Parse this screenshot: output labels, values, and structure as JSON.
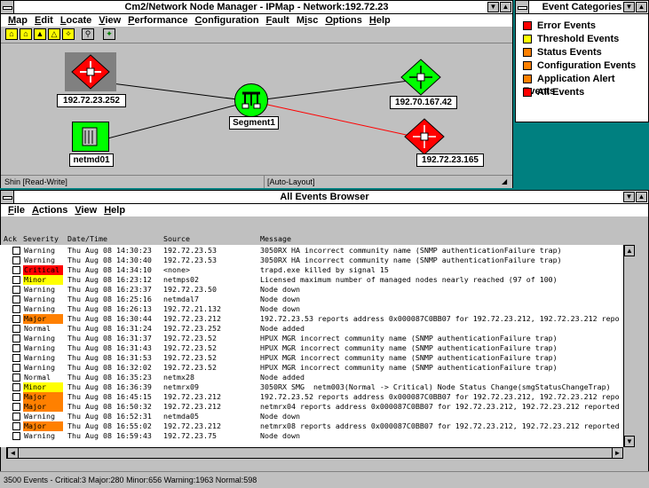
{
  "map_window": {
    "title": "Cm2/Network Node Manager - IPMap - Network:192.72.23",
    "menu": [
      {
        "label": "Map",
        "key": "M"
      },
      {
        "label": "Edit",
        "key": "E"
      },
      {
        "label": "Locate",
        "key": "L"
      },
      {
        "label": "View",
        "key": "V"
      },
      {
        "label": "Performance",
        "key": "P"
      },
      {
        "label": "Configuration",
        "key": "C"
      },
      {
        "label": "Fault",
        "key": "F"
      },
      {
        "label": "Misc",
        "key": "i"
      },
      {
        "label": "Options",
        "key": "O"
      },
      {
        "label": "Help",
        "key": "H"
      }
    ],
    "nodes": [
      {
        "label": "192.72.23.252",
        "color": "#ff0000",
        "icon": "router-icon"
      },
      {
        "label": "netmd01",
        "color": "#00ff00",
        "icon": "workstation-icon"
      },
      {
        "label": "Segment1",
        "color": "#00ff00",
        "icon": "segment-icon"
      },
      {
        "label": "192.70.167.42",
        "color": "#00ff00",
        "icon": "router-icon"
      },
      {
        "label": "192.72.23.165",
        "color": "#ff0000",
        "icon": "router-icon"
      }
    ],
    "status_left": "Shin [Read-Write]",
    "status_mid": "[Auto-Layout]"
  },
  "event_categories": {
    "title": "Event Categories",
    "items": [
      {
        "label": "Error Events",
        "color": "#ff0000"
      },
      {
        "label": "Threshold Events",
        "color": "#ffff00"
      },
      {
        "label": "Status Events",
        "color": "#ff8000"
      },
      {
        "label": "Configuration Events",
        "color": "#ff8000"
      },
      {
        "label": "Application Alert Events",
        "color": "#ff8000"
      },
      {
        "label": "All Events",
        "color": "#ff0000"
      }
    ]
  },
  "browser": {
    "title": "All Events Browser",
    "menu": [
      {
        "label": "File",
        "key": "F"
      },
      {
        "label": "Actions",
        "key": "A"
      },
      {
        "label": "View",
        "key": "V"
      },
      {
        "label": "Help",
        "key": "H"
      }
    ],
    "columns": {
      "ack": "Ack",
      "severity": "Severity",
      "date": "Date/Time",
      "source": "Source",
      "message": "Message"
    },
    "rows": [
      {
        "severity": "Warning",
        "color": "#ffffff",
        "date": "Thu Aug 08 14:30:23",
        "source": "192.72.23.53",
        "message": "3050RX HA incorrect community name (SNMP authenticationFailure trap)"
      },
      {
        "severity": "Warning",
        "color": "#ffffff",
        "date": "Thu Aug 08 14:30:40",
        "source": "192.72.23.53",
        "message": "3050RX HA incorrect community name (SNMP authenticationFailure trap)"
      },
      {
        "severity": "Critical",
        "color": "#ff0000",
        "date": "Thu Aug 08 14:34:10",
        "source": "<none>",
        "message": "trapd.exe killed by signal 15"
      },
      {
        "severity": "Minor",
        "color": "#ffff00",
        "date": "Thu Aug 08 16:23:12",
        "source": "netmps02",
        "message": "Licensed maximum number of managed nodes nearly reached (97 of 100)"
      },
      {
        "severity": "Warning",
        "color": "#ffffff",
        "date": "Thu Aug 08 16:23:37",
        "source": "192.72.23.50",
        "message": "Node down"
      },
      {
        "severity": "Warning",
        "color": "#ffffff",
        "date": "Thu Aug 08 16:25:16",
        "source": "netmdal7",
        "message": "Node down"
      },
      {
        "severity": "Warning",
        "color": "#ffffff",
        "date": "Thu Aug 08 16:26:13",
        "source": "192.72.21.132",
        "message": "Node down"
      },
      {
        "severity": "Major",
        "color": "#ff8000",
        "date": "Thu Aug 08 16:30:44",
        "source": "192.72.23.212",
        "message": "192.72.23.53 reports address 0x000087C0BB07 for 192.72.23.212, 192.72.23.212 repo"
      },
      {
        "severity": "Normal",
        "color": "#ffffff",
        "date": "Thu Aug 08 16:31:24",
        "source": "192.72.23.252",
        "message": "Node added"
      },
      {
        "severity": "Warning",
        "color": "#ffffff",
        "date": "Thu Aug 08 16:31:37",
        "source": "192.72.23.52",
        "message": "HPUX MGR incorrect community name (SNMP authenticationFailure trap)"
      },
      {
        "severity": "Warning",
        "color": "#ffffff",
        "date": "Thu Aug 08 16:31:43",
        "source": "192.72.23.52",
        "message": "HPUX MGR incorrect community name (SNMP authenticationFailure trap)"
      },
      {
        "severity": "Warning",
        "color": "#ffffff",
        "date": "Thu Aug 08 16:31:53",
        "source": "192.72.23.52",
        "message": "HPUX MGR incorrect community name (SNMP authenticationFailure trap)"
      },
      {
        "severity": "Warning",
        "color": "#ffffff",
        "date": "Thu Aug 08 16:32:02",
        "source": "192.72.23.52",
        "message": "HPUX MGR incorrect community name (SNMP authenticationFailure trap)"
      },
      {
        "severity": "Normal",
        "color": "#ffffff",
        "date": "Thu Aug 08 16:35:23",
        "source": "netmx28",
        "message": "Node added"
      },
      {
        "severity": "Minor",
        "color": "#ffff00",
        "date": "Thu Aug 08 16:36:39",
        "source": "netmrx09",
        "message": "3050RX SMG  netm003(Normal -> Critical) Node Status Change(smgStatusChangeTrap)"
      },
      {
        "severity": "Major",
        "color": "#ff8000",
        "date": "Thu Aug 08 16:45:15",
        "source": "192.72.23.212",
        "message": "192.72.23.52 reports address 0x000087C0BB07 for 192.72.23.212, 192.72.23.212 repo"
      },
      {
        "severity": "Major",
        "color": "#ff8000",
        "date": "Thu Aug 08 16:50:32",
        "source": "192.72.23.212",
        "message": "netmrx04 reports address 0x000087C0BB07 for 192.72.23.212, 192.72.23.212 reported"
      },
      {
        "severity": "Warning",
        "color": "#ffffff",
        "date": "Thu Aug 08 16:52:31",
        "source": "netmda05",
        "message": "Node down"
      },
      {
        "severity": "Major",
        "color": "#ff8000",
        "date": "Thu Aug 08 16:55:02",
        "source": "192.72.23.212",
        "message": "netmrx08 reports address 0x000087C0BB07 for 192.72.23.212, 192.72.23.212 reported"
      },
      {
        "severity": "Warning",
        "color": "#ffffff",
        "date": "Thu Aug 08 16:59:43",
        "source": "192.72.23.75",
        "message": "Node down"
      }
    ],
    "status": "3500 Events - Critical:3 Major:280 Minor:656 Warning:1963 Normal:598"
  }
}
